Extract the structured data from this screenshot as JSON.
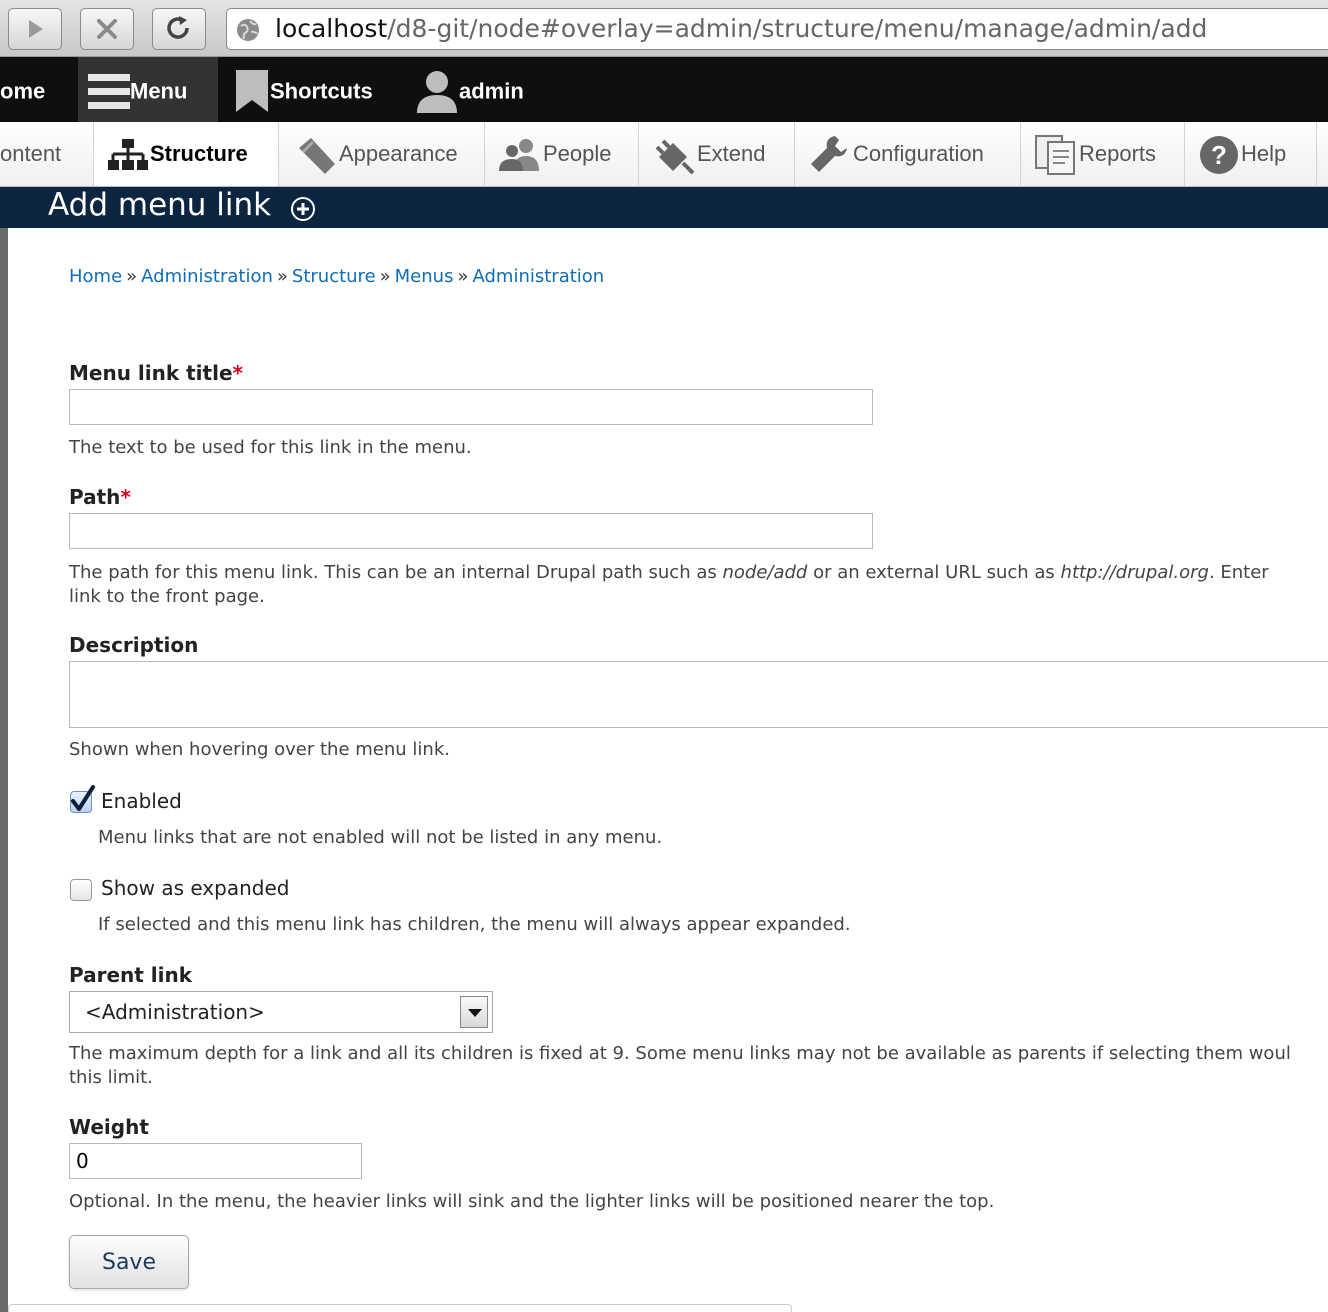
{
  "browser": {
    "url_host": "localhost",
    "url_path": "/d8-git/node#overlay=admin/structure/menu/manage/admin/add"
  },
  "toolbar": {
    "home_label": "ome",
    "menu_label": "Menu",
    "shortcuts_label": "Shortcuts",
    "user_label": "admin"
  },
  "tray": {
    "items": [
      {
        "label": "ontent"
      },
      {
        "label": "Structure"
      },
      {
        "label": "Appearance"
      },
      {
        "label": "People"
      },
      {
        "label": "Extend"
      },
      {
        "label": "Configuration"
      },
      {
        "label": "Reports"
      },
      {
        "label": "Help"
      }
    ]
  },
  "page": {
    "title": "Add menu link"
  },
  "breadcrumb": [
    "Home",
    "Administration",
    "Structure",
    "Menus",
    "Administration"
  ],
  "breadcrumb_separator": "»",
  "form": {
    "title": {
      "label": "Menu link title",
      "required_mark": "*",
      "value": "",
      "description": "The text to be used for this link in the menu."
    },
    "path": {
      "label": "Path",
      "required_mark": "*",
      "value": "",
      "desc_before": "The path for this menu link. This can be an internal Drupal path such as ",
      "desc_em1": "node/add",
      "desc_middle": " or an external URL such as ",
      "desc_em2": "http://drupal.org",
      "desc_after": ". Enter",
      "desc_line2": "link to the front page."
    },
    "description": {
      "label": "Description",
      "value": "",
      "help": "Shown when hovering over the menu link."
    },
    "enabled": {
      "label": "Enabled",
      "checked": true,
      "help": "Menu links that are not enabled will not be listed in any menu."
    },
    "expanded": {
      "label": "Show as expanded",
      "checked": false,
      "help": "If selected and this menu link has children, the menu will always appear expanded."
    },
    "parent": {
      "label": "Parent link",
      "selected": "<Administration>",
      "help_line1": "The maximum depth for a link and all its children is fixed at 9. Some menu links may not be available as parents if selecting them woul",
      "help_line2": "this limit."
    },
    "weight": {
      "label": "Weight",
      "value": "0",
      "help": "Optional. In the menu, the heavier links will sink and the lighter links will be positioned nearer the top."
    },
    "save_label": "Save"
  },
  "colors": {
    "link": "#0f6db6",
    "toolbar_bg": "#0f0f0f",
    "overlay_title_bg": "#0c2540",
    "required": "#d0021b"
  }
}
